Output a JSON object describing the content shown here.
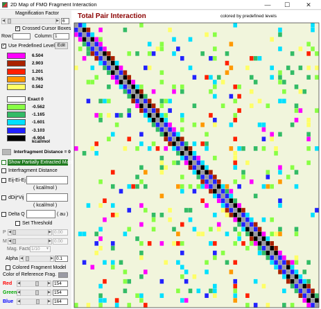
{
  "window": {
    "title": "2D Map of FMO Fragment Interaction",
    "minimize_glyph": "—",
    "maximize_glyph": "☐",
    "close_glyph": "✕"
  },
  "magnification": {
    "label": "Magnification Factor",
    "value": "6",
    "crossed_cursor_label": "Crossed Cursor Boxes",
    "crossed_cursor_checked": true,
    "row_label": "Row:",
    "row_value": "",
    "column_label": "Column:",
    "column_value": "1"
  },
  "levels": {
    "use_predefined_label": "Use Predefined Levels",
    "use_predefined_checked": true,
    "edit_button": "Edit",
    "items": [
      {
        "label": "6.504",
        "color": "#ff00ff"
      },
      {
        "label": "2.903",
        "color": "#aa2200"
      },
      {
        "label": "1.201",
        "color": "#ff2000"
      },
      {
        "label": "0.765",
        "color": "#ff9900"
      },
      {
        "label": "0.562",
        "color": "#ffff66"
      },
      {
        "label": "Exact  0",
        "color": "#ffffff"
      },
      {
        "label": "-0.562",
        "color": "#88ff44"
      },
      {
        "label": "-1.165",
        "color": "#33bb66"
      },
      {
        "label": "-1.601",
        "color": "#00e0ff"
      },
      {
        "label": "-3.103",
        "color": "#2222ff"
      },
      {
        "label": "-6.904",
        "color": "#000000"
      }
    ],
    "unit": "kcal/mol",
    "interfrag_distance_label": "Interfragment Distance = 0"
  },
  "options": {
    "show_partial_label": "Show Partially Extracted Map",
    "interfrag_distance_label": "Interfragment Distance",
    "eij_label": "Eij-Ei-Ej",
    "eij_unit": "( kcal/mol )",
    "ddij_label": "dDij*Vij",
    "ddij_unit": "( kcal/mol )",
    "deltaq_label": "Delta Q",
    "deltaq_unit": "( au )",
    "set_threshold_label": "Set Threshold",
    "p_label": "P",
    "p_value": "0.00",
    "m_label": "M",
    "m_value": "0.00",
    "mag_factor_label": "Mag. Factor",
    "mag_factor_value": "1/10",
    "alpha_label": "Alpha",
    "alpha_value": "0.1",
    "colored_model_label": "Colored Fragment Model",
    "ref_color_label": "Color of Reference Frag.",
    "red_label": "Red",
    "red_value": "154",
    "green_label": "Green",
    "green_value": "154",
    "blue_label": "Blue",
    "blue_value": "164",
    "red_color": "#ff0000",
    "green_color": "#00aa00",
    "blue_color": "#0000ff"
  },
  "plot": {
    "title": "Total Pair Interaction",
    "subtitle": "colored by predefined levels",
    "title_color": "#8b0000",
    "grid_size": 60,
    "diagonal_color": "#9a9aa2",
    "background_cell_color": "#f1f5dc"
  }
}
